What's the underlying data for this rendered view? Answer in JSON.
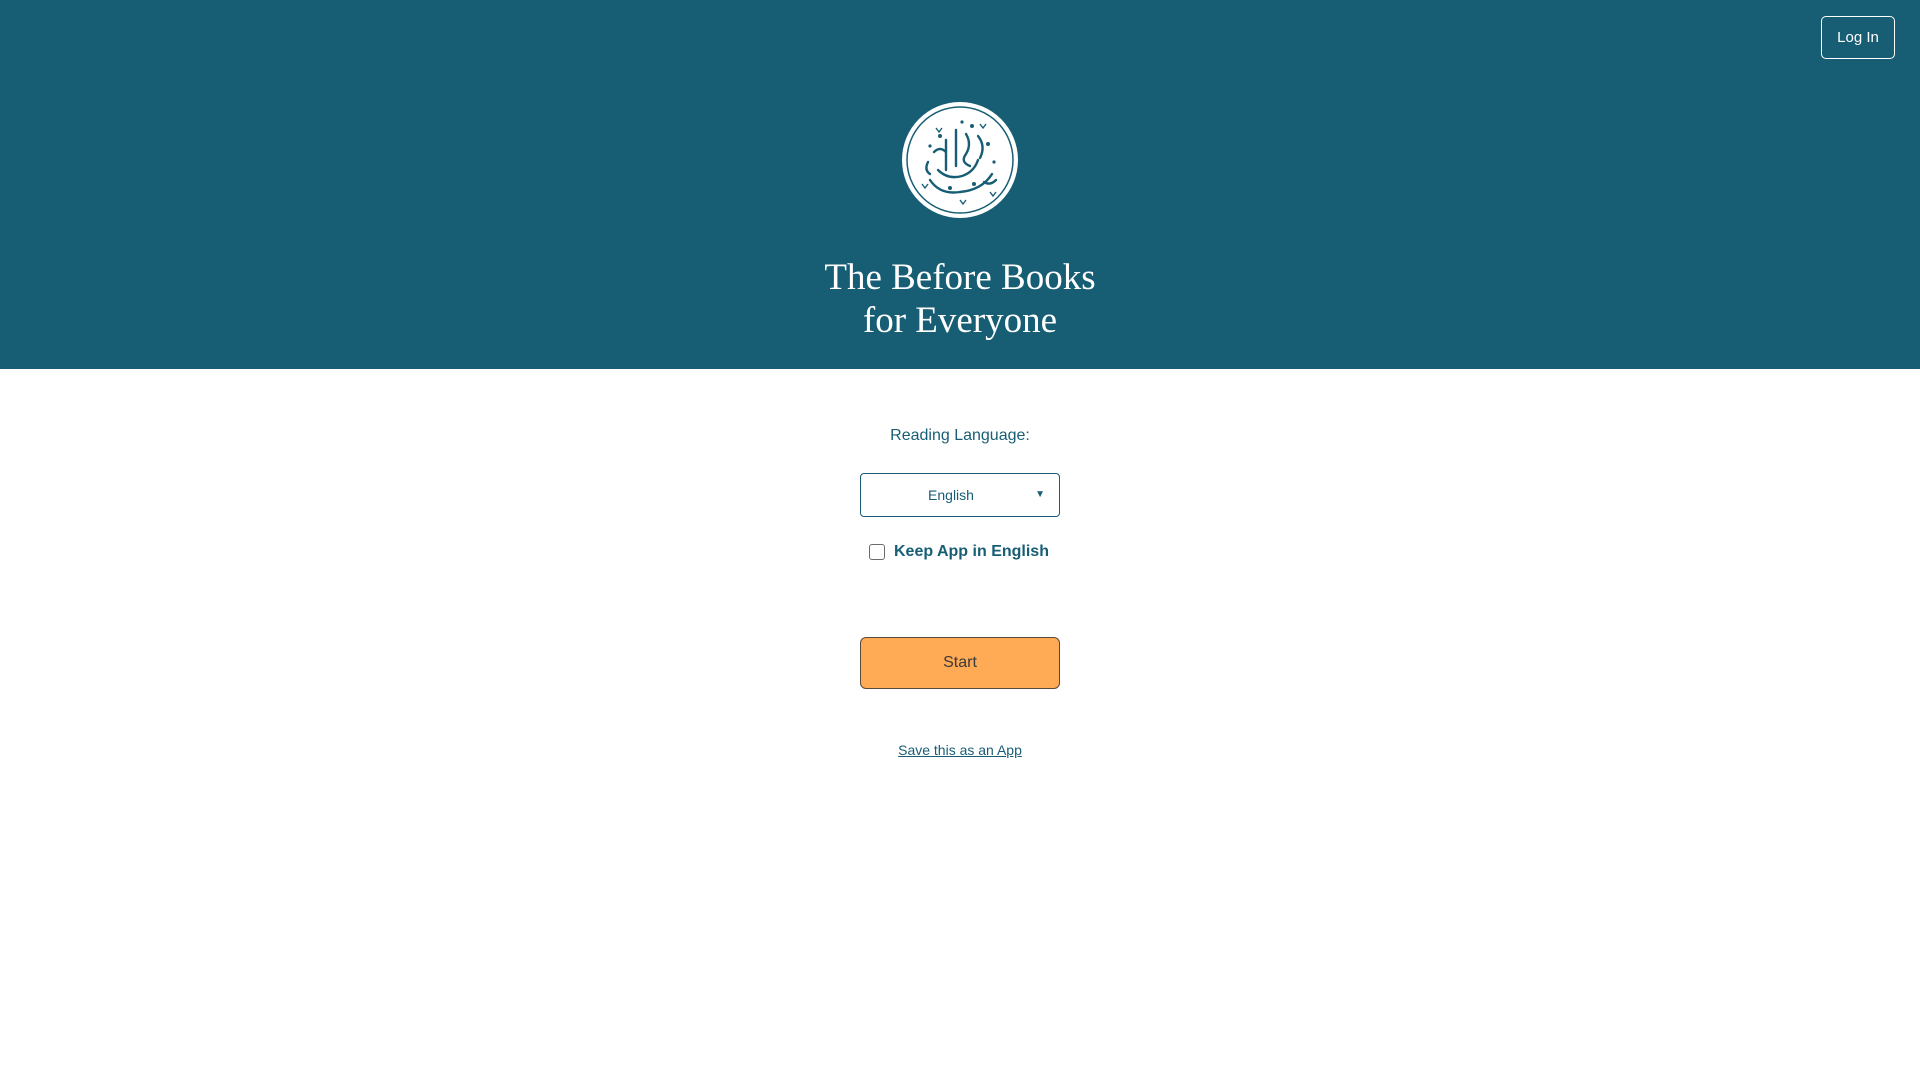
{
  "header": {
    "login_label": "Log In",
    "title_line1": "The Before Books",
    "title_line2": "for Everyone",
    "logo_icon": "arabic-calligraphy-seal-icon",
    "background_color": "#175e75"
  },
  "language": {
    "label": "Reading Language:",
    "selected": "English"
  },
  "keep_app": {
    "label": "Keep App in English",
    "checked": false
  },
  "start_label": "Start",
  "save_app_link": "Save this as an App",
  "colors": {
    "primary": "#175e75",
    "start_button": "#ffaa55"
  }
}
